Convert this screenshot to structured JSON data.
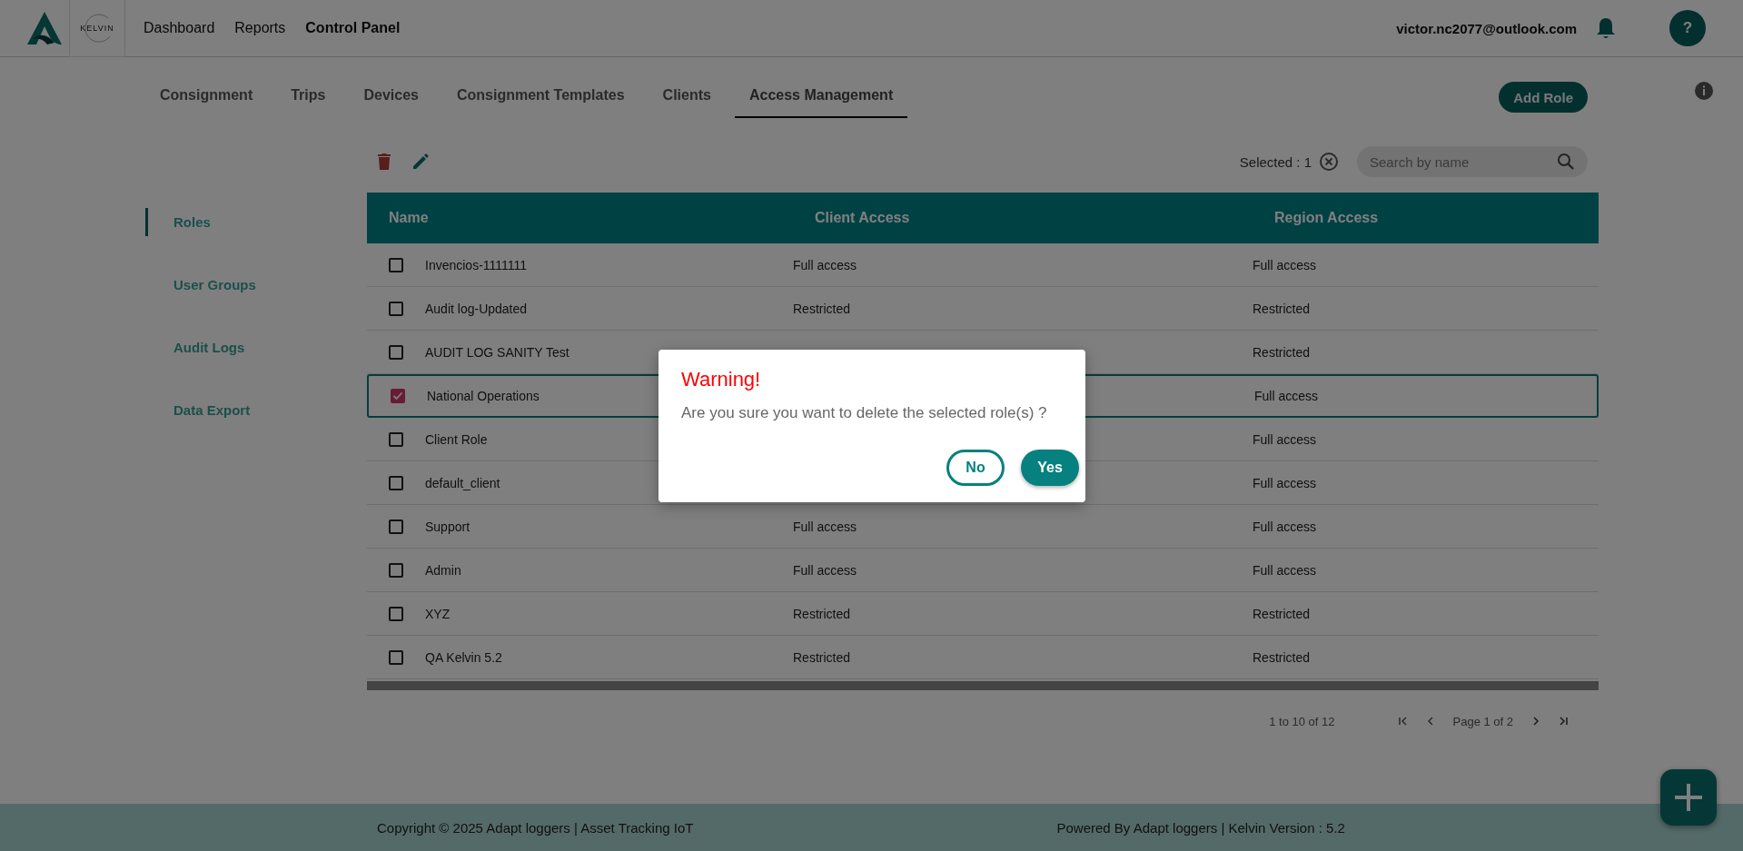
{
  "header": {
    "logo_text": "KELVIN",
    "nav": [
      {
        "label": "Dashboard",
        "selected": false
      },
      {
        "label": "Reports",
        "selected": false
      },
      {
        "label": "Control Panel",
        "selected": true
      }
    ],
    "email": "victor.nc2077@outlook.com",
    "help": "?"
  },
  "tabs": [
    {
      "label": "Consignment",
      "selected": false
    },
    {
      "label": "Trips",
      "selected": false
    },
    {
      "label": "Devices",
      "selected": false
    },
    {
      "label": "Consignment Templates",
      "selected": false
    },
    {
      "label": "Clients",
      "selected": false
    },
    {
      "label": "Access Management",
      "selected": true
    }
  ],
  "add_button": "Add Role",
  "toolbar": {
    "selected_label": "Selected : 1",
    "search": {
      "placeholder": "Search by name"
    }
  },
  "sidebar": {
    "items": [
      {
        "label": "Roles",
        "selected": true
      },
      {
        "label": "User Groups",
        "selected": false
      },
      {
        "label": "Audit Logs",
        "selected": false
      },
      {
        "label": "Data Export",
        "selected": false
      }
    ]
  },
  "table": {
    "columns": [
      "Name",
      "Client Access",
      "Region Access"
    ],
    "rows": [
      {
        "name": "Invencios-1111111",
        "client_access": "Full access",
        "region_access": "Full access",
        "checked": false
      },
      {
        "name": "Audit log-Updated",
        "client_access": "Restricted",
        "region_access": "Restricted",
        "checked": false
      },
      {
        "name": "AUDIT LOG SANITY Test",
        "region_access": "Restricted",
        "checked": false
      },
      {
        "name": "National Operations",
        "region_access": "Full access",
        "checked": true
      },
      {
        "name": "Client Role",
        "region_access": "Full access",
        "checked": false
      },
      {
        "name": "default_client",
        "region_access": "Full access",
        "checked": false
      },
      {
        "name": "Support",
        "client_access": "Full access",
        "region_access": "Full access",
        "checked": false
      },
      {
        "name": "Admin",
        "client_access": "Full access",
        "region_access": "Full access",
        "checked": false
      },
      {
        "name": "XYZ",
        "client_access": "Restricted",
        "region_access": "Restricted",
        "checked": false
      },
      {
        "name": "QA Kelvin 5.2",
        "client_access": "Restricted",
        "region_access": "Restricted",
        "checked": false
      }
    ]
  },
  "pagination": {
    "range": "1 to 10 of 12",
    "page": "Page 1 of 2"
  },
  "footer": {
    "copyright": "Copyright © 2025 Adapt loggers | Asset Tracking IoT",
    "powered": "Powered By Adapt loggers | Kelvin Version : 5.2"
  },
  "dialog": {
    "title": "Warning!",
    "message": "Are you sure you want to delete the selected role(s) ?",
    "buttons": [
      {
        "label": "No",
        "kind": "outline"
      },
      {
        "label": "Yes",
        "kind": "filled"
      }
    ]
  }
}
